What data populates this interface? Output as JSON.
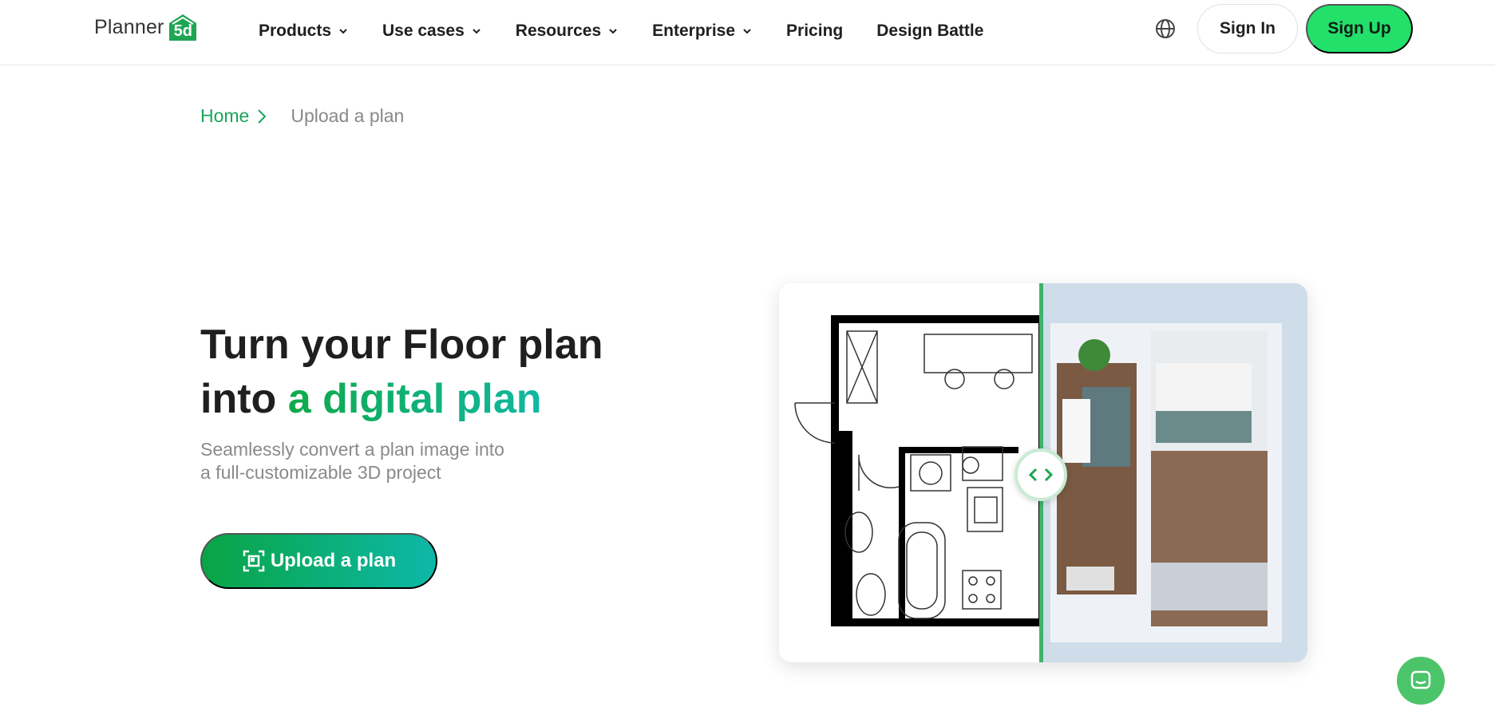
{
  "header": {
    "logo_text": "Planner",
    "logo_mark_text": "5d",
    "nav": [
      {
        "label": "Products",
        "dropdown": true
      },
      {
        "label": "Use cases",
        "dropdown": true
      },
      {
        "label": "Resources",
        "dropdown": true
      },
      {
        "label": "Enterprise",
        "dropdown": true
      },
      {
        "label": "Pricing",
        "dropdown": false
      },
      {
        "label": "Design Battle",
        "dropdown": false
      }
    ],
    "globe_icon": "globe-icon",
    "sign_in": "Sign In",
    "sign_up": "Sign Up"
  },
  "breadcrumb": {
    "home": "Home",
    "current": "Upload a plan"
  },
  "hero": {
    "title_line1": "Turn your Floor plan",
    "title_line2_prefix": "into ",
    "title_accent": "a digital plan",
    "subtitle_line1": "Seamlessly convert a plan image into",
    "subtitle_line2": "a full-customizable 3D project",
    "upload_button": "Upload a plan"
  },
  "colors": {
    "brand_green": "#22e06a",
    "accent_green": "#19a55a",
    "gradient_start": "#09a444",
    "gradient_end": "#0db8a8"
  }
}
